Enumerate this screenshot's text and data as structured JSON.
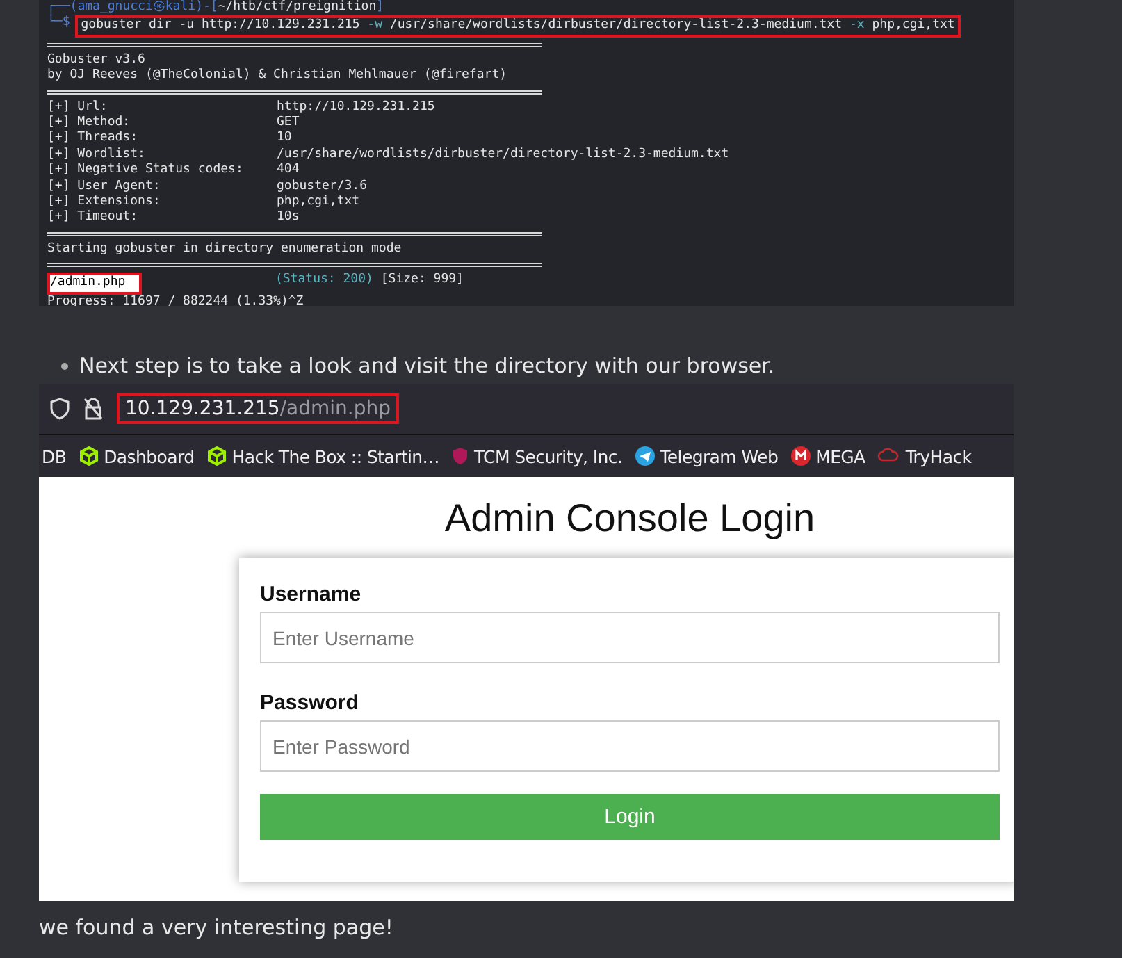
{
  "terminal": {
    "prompt": {
      "open": "┌──(",
      "user": "ama_gnucci",
      "at": "㉿",
      "host": "kali",
      "mid": ")-[",
      "path": "~/htb/ctf/preignition",
      "close": "]",
      "sign": "└─$"
    },
    "command": [
      {
        "text": "gobuster dir -u http://10.129.231.215 ",
        "kind": "plain"
      },
      {
        "text": "-w",
        "kind": "flag"
      },
      {
        "text": " /usr/share/wordlists/dirbuster/directory-list-2.3-medium.txt ",
        "kind": "plain"
      },
      {
        "text": "-x",
        "kind": "flag"
      },
      {
        "text": " php,cgi,txt",
        "kind": "plain"
      }
    ],
    "banner": [
      "Gobuster v3.6",
      "by OJ Reeves (@TheColonial) & Christian Mehlmauer (@firefart)"
    ],
    "settings": [
      {
        "label": "[+] Url:",
        "value": "http://10.129.231.215"
      },
      {
        "label": "[+] Method:",
        "value": "GET"
      },
      {
        "label": "[+] Threads:",
        "value": "10"
      },
      {
        "label": "[+] Wordlist:",
        "value": "/usr/share/wordlists/dirbuster/directory-list-2.3-medium.txt"
      },
      {
        "label": "[+] Negative Status codes:",
        "value": "404"
      },
      {
        "label": "[+] User Agent:",
        "value": "gobuster/3.6"
      },
      {
        "label": "[+] Extensions:",
        "value": "php,cgi,txt"
      },
      {
        "label": "[+] Timeout:",
        "value": "10s"
      }
    ],
    "start_message": "Starting gobuster in directory enumeration mode",
    "results": [
      {
        "path": "/admin.php",
        "status": "(Status: 200)",
        "size": "[Size: 999]",
        "highlighted": true
      }
    ],
    "progress": "Progress: 11697 / 882244 (1.33%)^Z"
  },
  "bullet": "Next step is to take a look and visit the directory with our browser.",
  "browser": {
    "url_host": "10.129.231.215",
    "url_path": "/admin.php",
    "bookmarks": [
      {
        "label": "DB",
        "kind": "none"
      },
      {
        "label": "Dashboard",
        "kind": "cube"
      },
      {
        "label": "Hack The Box :: Startin…",
        "kind": "cube"
      },
      {
        "label": "TCM Security, Inc.",
        "kind": "shield"
      },
      {
        "label": "Telegram Web",
        "kind": "telegram"
      },
      {
        "label": "MEGA",
        "kind": "mega"
      },
      {
        "label": "TryHack",
        "kind": "cloud"
      }
    ],
    "page": {
      "title": "Admin Console Login",
      "fields": [
        {
          "label": "Username",
          "placeholder": "Enter Username"
        },
        {
          "label": "Password",
          "placeholder": "Enter Password"
        }
      ],
      "button": "Login"
    }
  },
  "caption": "we found a very interesting page!"
}
